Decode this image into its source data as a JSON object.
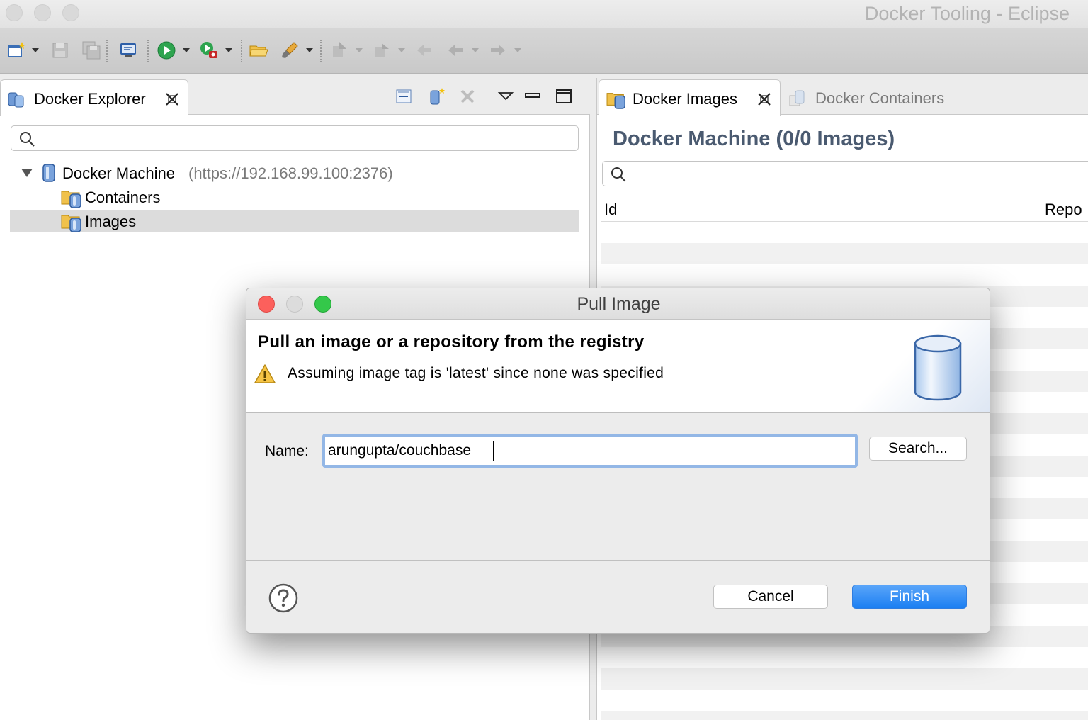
{
  "window": {
    "title": "Docker Tooling - Eclipse"
  },
  "toolbar": {
    "icons": [
      "new-wizard-icon",
      "save-icon",
      "save-all-icon",
      "terminal-icon",
      "run-icon",
      "debug-icon",
      "open-folder-icon",
      "paint-brush-icon",
      "next-annotation-icon",
      "previous-annotation-icon",
      "back-icon",
      "forward-icon"
    ]
  },
  "explorer": {
    "tab_label": "Docker Explorer",
    "filter_placeholder": "",
    "tree": {
      "root_label": "Docker Machine",
      "root_url": "(https://192.168.99.100:2376)",
      "children": [
        "Containers",
        "Images"
      ],
      "selected": "Images"
    }
  },
  "images_view": {
    "tabs": [
      {
        "label": "Docker Images",
        "active": true
      },
      {
        "label": "Docker Containers",
        "active": false
      }
    ],
    "heading": "Docker Machine (0/0 Images)",
    "filter_placeholder": "",
    "columns": [
      "Id",
      "Repo"
    ]
  },
  "dialog": {
    "title": "Pull Image",
    "heading": "Pull an image or a repository from the registry",
    "message": "Assuming image tag is 'latest' since none was specified",
    "name_label": "Name:",
    "name_value": "arungupta/couchbase",
    "search_button": "Search...",
    "cancel_button": "Cancel",
    "finish_button": "Finish",
    "colors": {
      "primary": "#1b7ff2",
      "focus_ring": "#93b7e6",
      "warning": "#f6c445"
    }
  }
}
